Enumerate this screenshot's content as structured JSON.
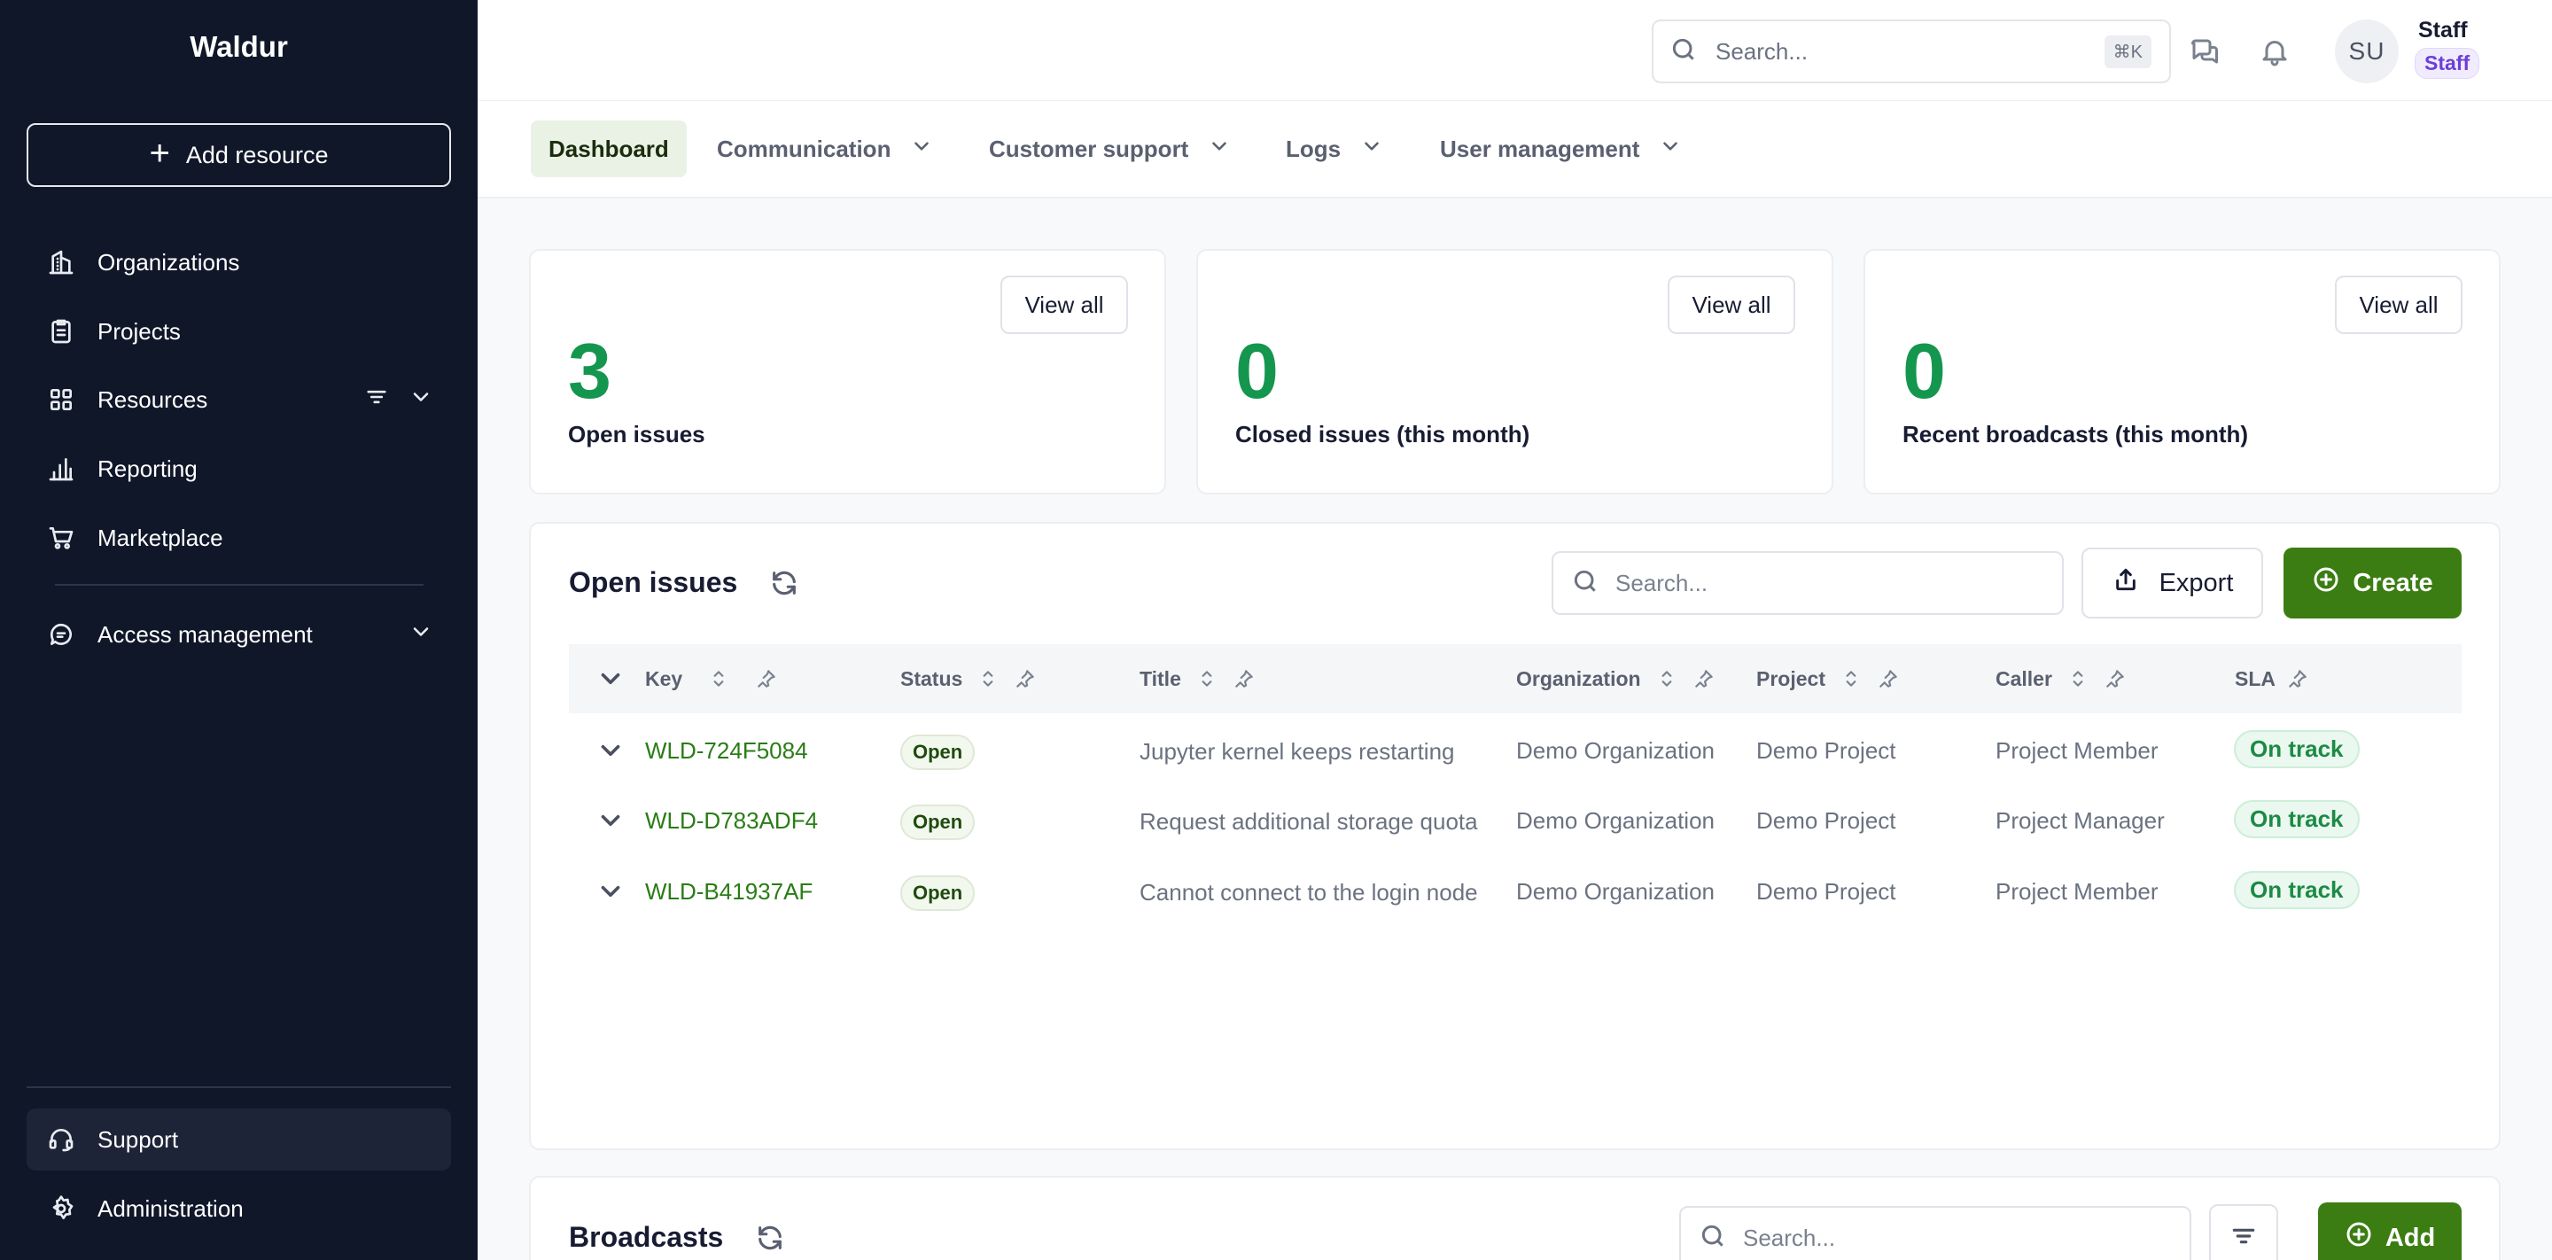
{
  "app": {
    "name": "Waldur"
  },
  "sidebar": {
    "add_resource": "Add resource",
    "items": [
      {
        "label": "Organizations",
        "icon": "building-icon"
      },
      {
        "label": "Projects",
        "icon": "clipboard-icon"
      },
      {
        "label": "Resources",
        "icon": "grid-icon"
      },
      {
        "label": "Reporting",
        "icon": "bar-chart-icon"
      },
      {
        "label": "Marketplace",
        "icon": "cart-icon"
      },
      {
        "label": "Access management",
        "icon": "chat-lock-icon"
      }
    ],
    "bottom_items": [
      {
        "label": "Support",
        "icon": "headset-icon"
      },
      {
        "label": "Administration",
        "icon": "gear-icon"
      }
    ]
  },
  "topbar": {
    "search_placeholder": "Search...",
    "shortcut": "⌘K",
    "user_initials": "SU",
    "user_name": "Staff",
    "user_role": "Staff"
  },
  "tabs": [
    {
      "label": "Dashboard",
      "active": true
    },
    {
      "label": "Communication"
    },
    {
      "label": "Customer support"
    },
    {
      "label": "Logs"
    },
    {
      "label": "User management"
    }
  ],
  "stats": [
    {
      "value": "3",
      "label": "Open issues",
      "button": "View all"
    },
    {
      "value": "0",
      "label": "Closed issues (this month)",
      "button": "View all"
    },
    {
      "value": "0",
      "label": "Recent broadcasts (this month)",
      "button": "View all"
    }
  ],
  "issues": {
    "title": "Open issues",
    "search_placeholder": "Search...",
    "export_label": "Export",
    "create_label": "Create",
    "columns": [
      "Key",
      "Status",
      "Title",
      "Organization",
      "Project",
      "Caller",
      "SLA"
    ],
    "rows": [
      {
        "key": "WLD-724F5084",
        "status": "Open",
        "title": "Jupyter kernel keeps restarting",
        "organization": "Demo Organization",
        "project": "Demo Project",
        "caller": "Project Member",
        "sla": "On track"
      },
      {
        "key": "WLD-D783ADF4",
        "status": "Open",
        "title": "Request additional storage quota",
        "organization": "Demo Organization",
        "project": "Demo Project",
        "caller": "Project Manager",
        "sla": "On track"
      },
      {
        "key": "WLD-B41937AF",
        "status": "Open",
        "title": "Cannot connect to the login node",
        "organization": "Demo Organization",
        "project": "Demo Project",
        "caller": "Project Member",
        "sla": "On track"
      }
    ]
  },
  "broadcasts": {
    "title": "Broadcasts",
    "search_placeholder": "Search...",
    "add_label": "Add"
  },
  "colors": {
    "sidebar_bg": "#0f1729",
    "accent_green": "#3b7d12",
    "stat_green": "#15964f"
  }
}
